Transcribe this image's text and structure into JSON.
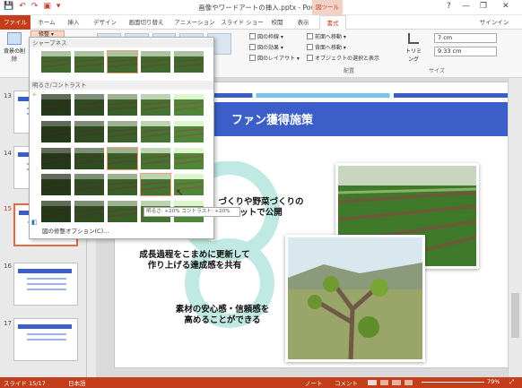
{
  "window": {
    "title": "画像やワードアートの挿入.pptx - PowerPoint",
    "context_tab_group": "図ツール",
    "help": "?",
    "minimize": "—",
    "restore": "❐",
    "close": "✕"
  },
  "qat": {
    "save": "💾",
    "undo": "↶",
    "redo": "↷",
    "start": "▣",
    "more": "▾"
  },
  "tabs": {
    "file": "ファイル",
    "items": [
      "ホーム",
      "挿入",
      "デザイン",
      "画面切り替え",
      "アニメーション",
      "スライド ショー",
      "校閲",
      "表示",
      "書式"
    ],
    "signin": "サインイン"
  },
  "ribbon": {
    "remove_bg": "背景の削除",
    "corrections": "修整 ▾",
    "picture_border": "図の枠線 ▾",
    "picture_effects": "図の効果 ▾",
    "picture_layout": "図のレイアウト ▾",
    "bring_forward": "前面へ移動 ▾",
    "send_backward": "背面へ移動 ▾",
    "selection_pane": "オブジェクトの選択と表示",
    "arrange_group": "配置",
    "trimming": "トリミング",
    "height": "7 cm",
    "width": "9.33 cm",
    "size_group": "サイズ"
  },
  "dropdown": {
    "sharpness_header": "シャープネス",
    "brightness_header": "明るさ/コントラスト",
    "tooltip": "明るさ: +20% コントラスト: +20%",
    "picture_options": "図の修整オプション(C)..."
  },
  "thumbnails": {
    "numbers": [
      "13",
      "14",
      "15",
      "16",
      "17"
    ]
  },
  "slide": {
    "title_num": "②",
    "title": "ファン獲得施策",
    "text1_line1": "づくりや野菜づくりの",
    "text1_line2": "ットで公開",
    "text2_line1": "成長過程をこまめに更新して",
    "text2_line2": "作り上げる達成感を共有",
    "text3_line1": "素材の安心感・信頼感を",
    "text3_line2": "高めることができる"
  },
  "status": {
    "slide": "スライド 15/17",
    "lang": "日本語",
    "notes": "ノート",
    "comments": "コメント",
    "zoom": "79%",
    "fit": "⤢"
  },
  "colors": {
    "accent": "#c43e1c",
    "title_band": "#3b5ec8",
    "arrow": "#bfe9e2",
    "field": "#3e6a2c"
  }
}
